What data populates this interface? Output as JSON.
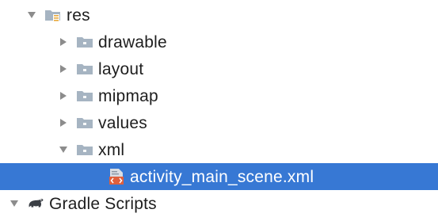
{
  "tree": {
    "items": [
      {
        "label": "res",
        "icon": "resource-folder-icon",
        "expand": "expanded"
      },
      {
        "label": "drawable",
        "icon": "folder-icon",
        "expand": "collapsed"
      },
      {
        "label": "layout",
        "icon": "folder-icon",
        "expand": "collapsed"
      },
      {
        "label": "mipmap",
        "icon": "folder-icon",
        "expand": "collapsed"
      },
      {
        "label": "values",
        "icon": "folder-icon",
        "expand": "collapsed"
      },
      {
        "label": "xml",
        "icon": "folder-icon",
        "expand": "expanded"
      },
      {
        "label": "activity_main_scene.xml",
        "icon": "xml-file-icon",
        "expand": "none",
        "selected": true
      },
      {
        "label": "Gradle Scripts",
        "icon": "gradle-elephant-icon",
        "expand": "expanded"
      }
    ]
  },
  "colors": {
    "selection": "#3778d4",
    "folder": "#a6b4c2",
    "arrow": "#8c8c8c",
    "text": "#1e1e1e"
  }
}
